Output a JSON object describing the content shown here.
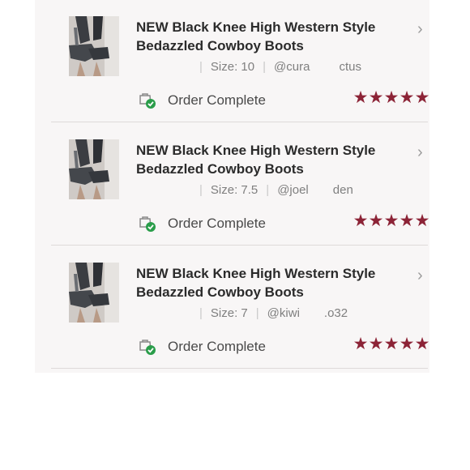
{
  "orders": [
    {
      "title_line1": "NEW Black Knee High Western Style",
      "title_line2": "Bedazzled Cowboy Boots",
      "size": "Size: 10",
      "username": "@cura            ctus",
      "status": "Order Complete",
      "rating": 5
    },
    {
      "title_line1": "NEW Black Knee High Western Style",
      "title_line2": "Bedazzled Cowboy Boots",
      "size": "Size: 7.5",
      "username": "@joel          den",
      "status": "Order Complete",
      "rating": 5
    },
    {
      "title_line1": "NEW Black Knee High Western Style",
      "title_line2": "Bedazzled Cowboy Boots",
      "size": "Size: 7",
      "username": "@kiwi          .o32",
      "status": "Order Complete",
      "rating": 5
    }
  ],
  "icons": {
    "chevron": "chevron-right-icon",
    "status": "order-complete-icon",
    "star": "star-icon"
  },
  "colors": {
    "star": "#8c2336",
    "check": "#2a9d4a",
    "list_background": "#f8f6f6"
  }
}
